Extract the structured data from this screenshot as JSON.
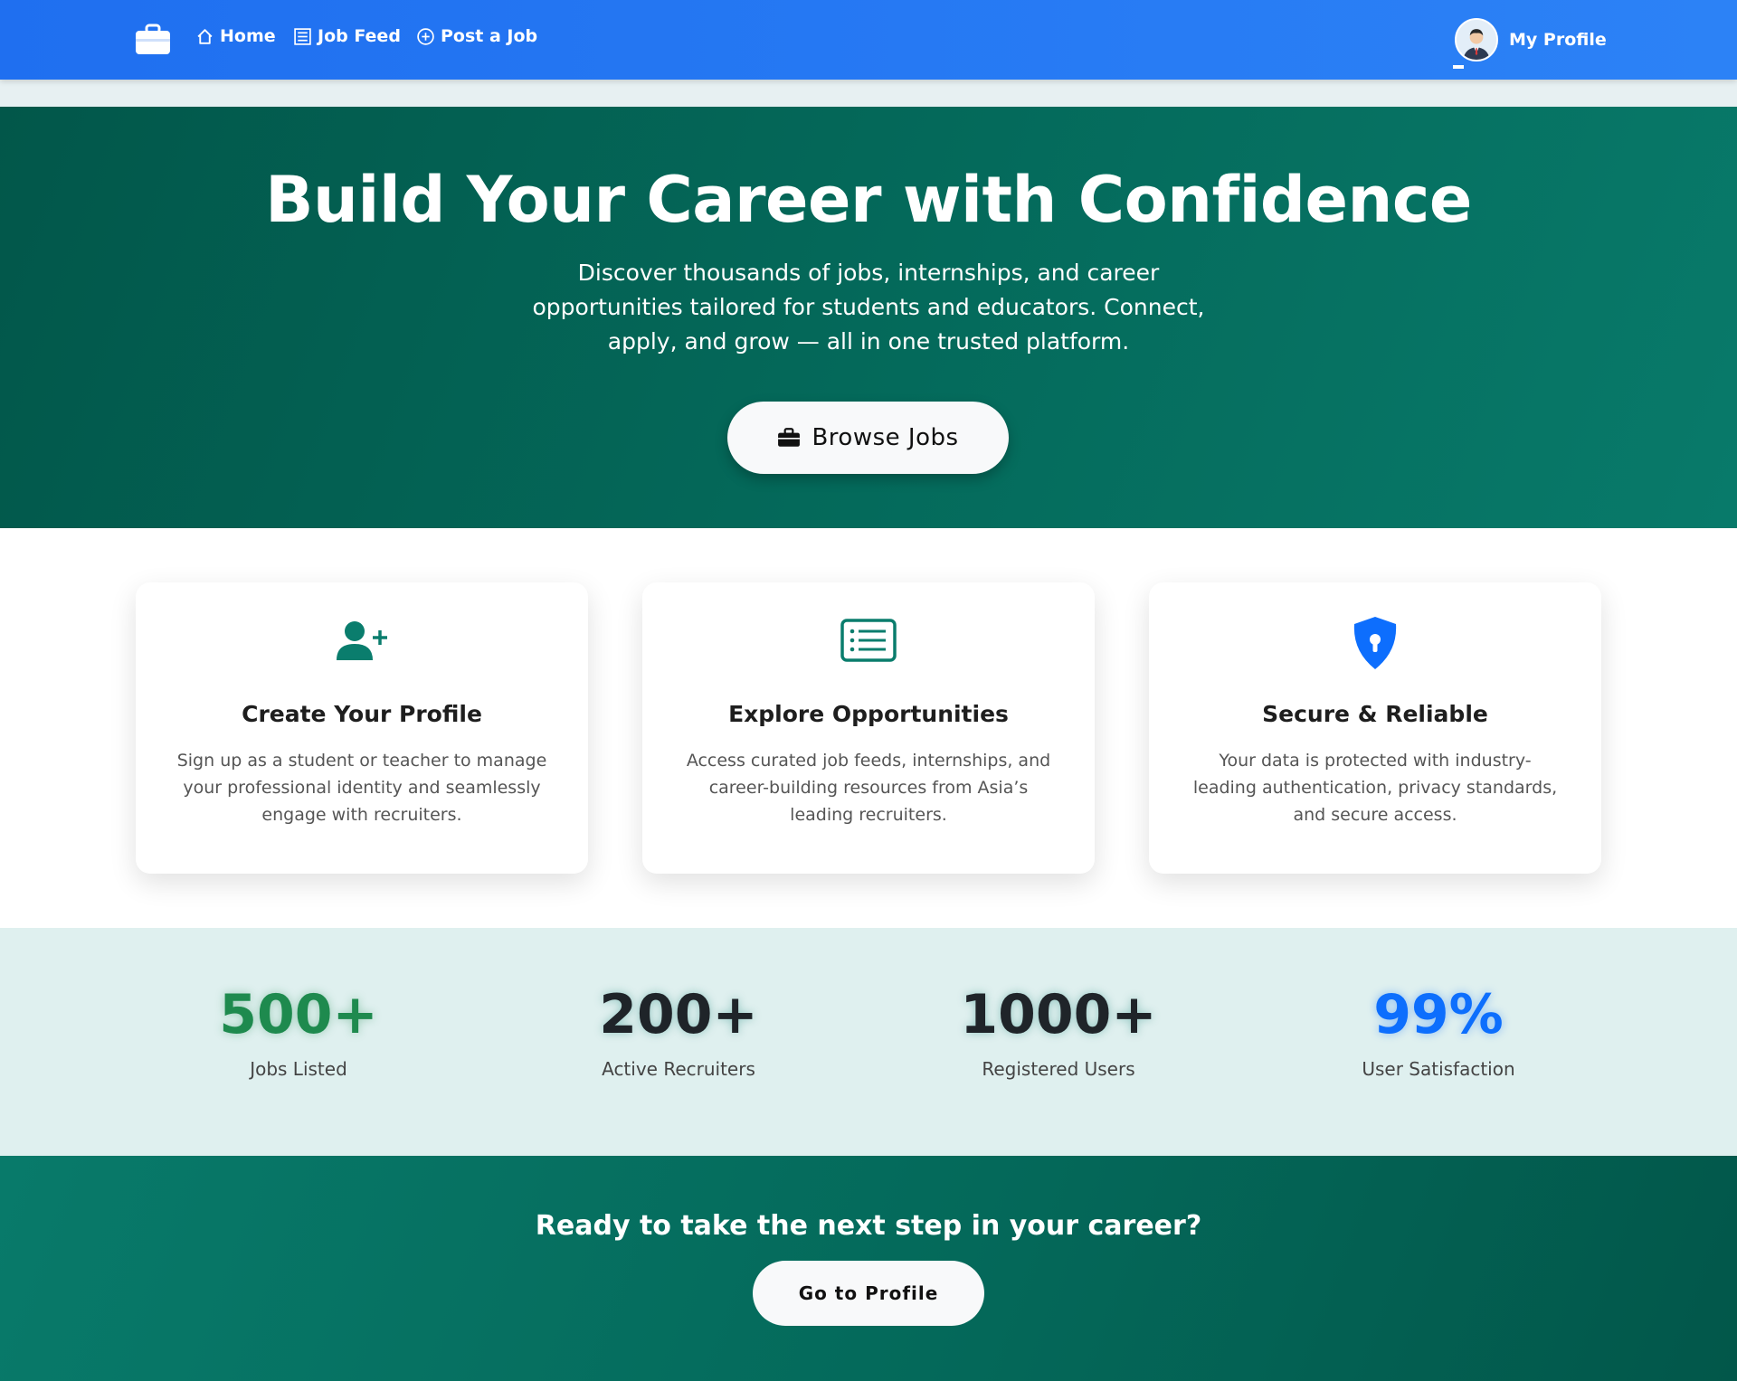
{
  "nav": {
    "brand_icon": "briefcase-icon",
    "links": [
      {
        "label": "Home",
        "icon": "house-icon"
      },
      {
        "label": "Job Feed",
        "icon": "list-icon"
      },
      {
        "label": "Post a Job",
        "icon": "plus-circle-icon"
      }
    ],
    "profile_label": "My Profile"
  },
  "hero": {
    "title": "Build Your Career with Confidence",
    "subtitle": "Discover thousands of jobs, internships, and career opportunities tailored for students and educators. Connect, apply, and grow — all in one trusted platform.",
    "button_label": "Browse Jobs"
  },
  "features": [
    {
      "icon": "person-plus-icon",
      "title": "Create Your Profile",
      "text": "Sign up as a student or teacher to manage your professional identity and seamlessly engage with recruiters."
    },
    {
      "icon": "card-list-icon",
      "title": "Explore Opportunities",
      "text": "Access curated job feeds, internships, and career-building resources from Asia’s leading recruiters."
    },
    {
      "icon": "shield-lock-icon",
      "title": "Secure & Reliable",
      "text": "Your data is protected with industry-leading authentication, privacy standards, and secure access."
    }
  ],
  "stats": [
    {
      "value": "500+",
      "label": "Jobs Listed",
      "color": "#1e8a4e"
    },
    {
      "value": "200+",
      "label": "Active Recruiters",
      "color": "#1f2429"
    },
    {
      "value": "1000+",
      "label": "Registered Users",
      "color": "#1f2429"
    },
    {
      "value": "99%",
      "label": "User Satisfaction",
      "color": "#0d6efd"
    }
  ],
  "cta": {
    "title": "Ready to take the next step in your career?",
    "button_label": "Go to Profile"
  },
  "colors": {
    "nav_blue": "#2c82f6",
    "teal_dark": "#02574a",
    "teal": "#087a6a",
    "accent_blue": "#0d6efd"
  }
}
